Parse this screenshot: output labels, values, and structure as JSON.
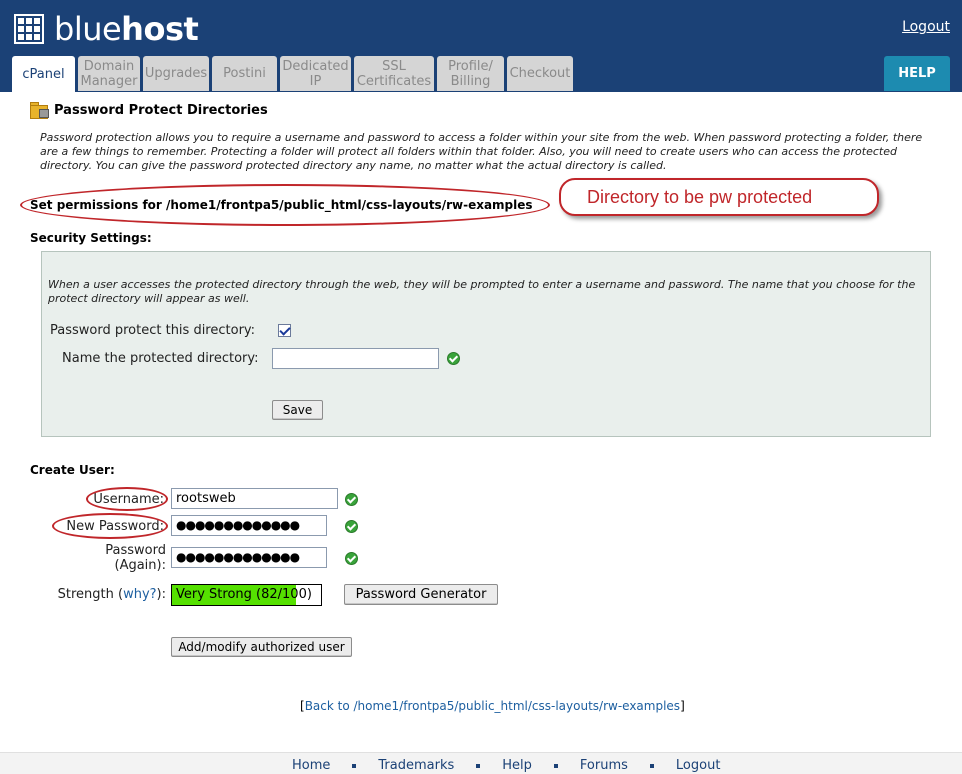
{
  "brand": {
    "logo_light": "blue",
    "logo_bold": "host"
  },
  "header": {
    "logout": "Logout",
    "help": "HELP"
  },
  "tabs": [
    {
      "line1": "cPanel",
      "line2": ""
    },
    {
      "line1": "Domain",
      "line2": "Manager"
    },
    {
      "line1": "Upgrades",
      "line2": ""
    },
    {
      "line1": "Postini",
      "line2": ""
    },
    {
      "line1": "Dedicated",
      "line2": "IP"
    },
    {
      "line1": "SSL",
      "line2": "Certificates"
    },
    {
      "line1": "Profile/",
      "line2": "Billing"
    },
    {
      "line1": "Checkout",
      "line2": ""
    }
  ],
  "page": {
    "title": "Password Protect Directories",
    "intro": "Password protection allows you to require a username and password to access a folder within your site from the web. When password protecting a folder, there are a few things to remember. Protecting a folder will protect all folders within that folder. Also, you will need to create users who can access the protected directory. You can give the password protected directory any name, no matter what the actual directory is called.",
    "permissions": "Set permissions for /home1/frontpa5/public_html/css-layouts/rw-examples",
    "callout": "Directory to be pw protected"
  },
  "security": {
    "heading": "Security Settings:",
    "description": "When a user accesses the protected directory through the web, they will be prompted to enter a username and password. The name that you choose for the protect directory will appear as well.",
    "protect_label": "Password protect this directory:",
    "protect_checked": true,
    "name_label": "Name the protected directory:",
    "name_value": "",
    "save": "Save"
  },
  "create_user": {
    "heading": "Create User:",
    "username_label": "Username:",
    "username_value": "rootsweb",
    "new_password_label": "New Password:",
    "new_password_value": "●●●●●●●●●●●●●",
    "password_again_label_1": "Password",
    "password_again_label_2": "(Again):",
    "password_again_value": "●●●●●●●●●●●●●",
    "strength_label": "Strength",
    "why": "why?",
    "strength_value": "Very Strong (82/100)",
    "strength_score": 82,
    "generator": "Password Generator",
    "add": "Add/modify authorized user"
  },
  "back": {
    "prefix": "[",
    "link": "Back to /home1/frontpa5/public_html/css-layouts/rw-examples",
    "suffix": "]"
  },
  "footer": [
    "Home",
    "Trademarks",
    "Help",
    "Forums",
    "Logout"
  ],
  "colors": {
    "brand_blue": "#1b4176",
    "help_blue": "#1d8bb0",
    "annotation_red": "#c0262a",
    "strength_green": "#55e000"
  }
}
